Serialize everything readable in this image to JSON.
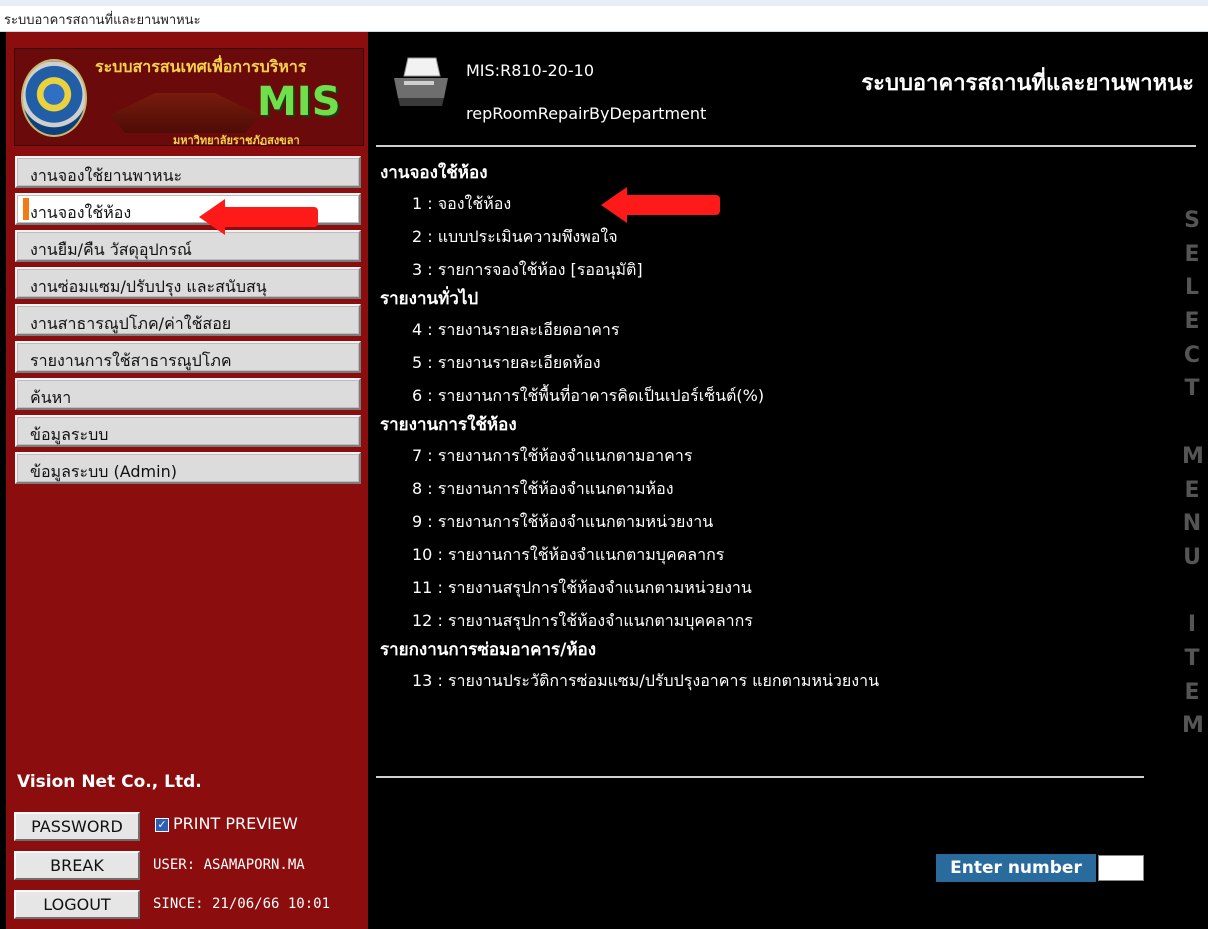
{
  "window": {
    "title": "ระบบอาคารสถานที่และยานพาหนะ"
  },
  "logo": {
    "text_top": "ระบบสารสนเทศเพื่อการบริหาร",
    "text_mis": "MIS",
    "text_bottom": "มหาวิทยาลัยราชภัฏสงขลา"
  },
  "sidebar": {
    "items": [
      {
        "label": "งานจองใช้ยานพาหนะ",
        "active": false
      },
      {
        "label": "งานจองใช้ห้อง",
        "active": true
      },
      {
        "label": "งานยืม/คืน วัสดุอุปกรณ์",
        "active": false
      },
      {
        "label": "งานซ่อมแซม/ปรับปรุง และสนับสนุ",
        "active": false
      },
      {
        "label": "งานสาธารณูปโภค/ค่าใช้สอย",
        "active": false
      },
      {
        "label": "รายงานการใช้สาธารณูปโภค",
        "active": false
      },
      {
        "label": "ค้นหา",
        "active": false
      },
      {
        "label": "ข้อมูลระบบ",
        "active": false
      },
      {
        "label": "ข้อมูลระบบ (Admin)",
        "active": false
      }
    ],
    "company": "Vision Net Co., Ltd.",
    "password_button": "PASSWORD",
    "print_preview_label": "PRINT PREVIEW",
    "print_preview_checked": true,
    "break_button": "BREAK",
    "logout_button": "LOGOUT",
    "user_text": "USER: ASAMAPORN.MA",
    "since_text": "SINCE: 21/06/66 10:01"
  },
  "header": {
    "code": "MIS:R810-20-10",
    "report_name": "repRoomRepairByDepartment",
    "system_title": "ระบบอาคารสถานที่และยานพาหนะ"
  },
  "menu": {
    "groups": [
      {
        "title": "งานจองใช้ห้อง",
        "items": [
          "1 : จองใช้ห้อง",
          "2 : แบบประเมินความพึงพอใจ",
          "3 : รายการจองใช้ห้อง [รออนุมัติ]"
        ]
      },
      {
        "title": "รายงานทั่วไป",
        "items": [
          "4 : รายงานรายละเอียดอาคาร",
          "5 : รายงานรายละเอียดห้อง",
          "6 : รายงานการใช้พื้นที่อาคารคิดเป็นเปอร์เซ็นต์(%)"
        ]
      },
      {
        "title": "รายงานการใช้ห้อง",
        "items": [
          "7 : รายงานการใช้ห้องจำแนกตามอาคาร",
          "8 : รายงานการใช้ห้องจำแนกตามห้อง",
          "9 : รายงานการใช้ห้องจำแนกตามหน่วยงาน",
          "10 : รายงานการใช้ห้องจำแนกตามบุคคลากร",
          "11 : รายงานสรุปการใช้ห้องจำแนกตามหน่วยงาน",
          "12 : รายงานสรุปการใช้ห้องจำแนกตามบุคคลากร"
        ]
      },
      {
        "title": "รายกงานการซ่อมอาคาร/ห้อง",
        "items": [
          "13 : รายงานประวัติการซ่อมแซม/ปรับปรุงอาคาร แยกตามหน่วยงาน"
        ]
      }
    ],
    "vertical_text": "SELECT MENU ITEM"
  },
  "enter_number": {
    "label": "Enter number",
    "value": ""
  },
  "colors": {
    "sidebar_bg": "#8b0d0d",
    "active_marker": "#f27b16",
    "annotation_arrow": "#ff1a1a",
    "enter_label_bg": "#2a6b9e"
  }
}
